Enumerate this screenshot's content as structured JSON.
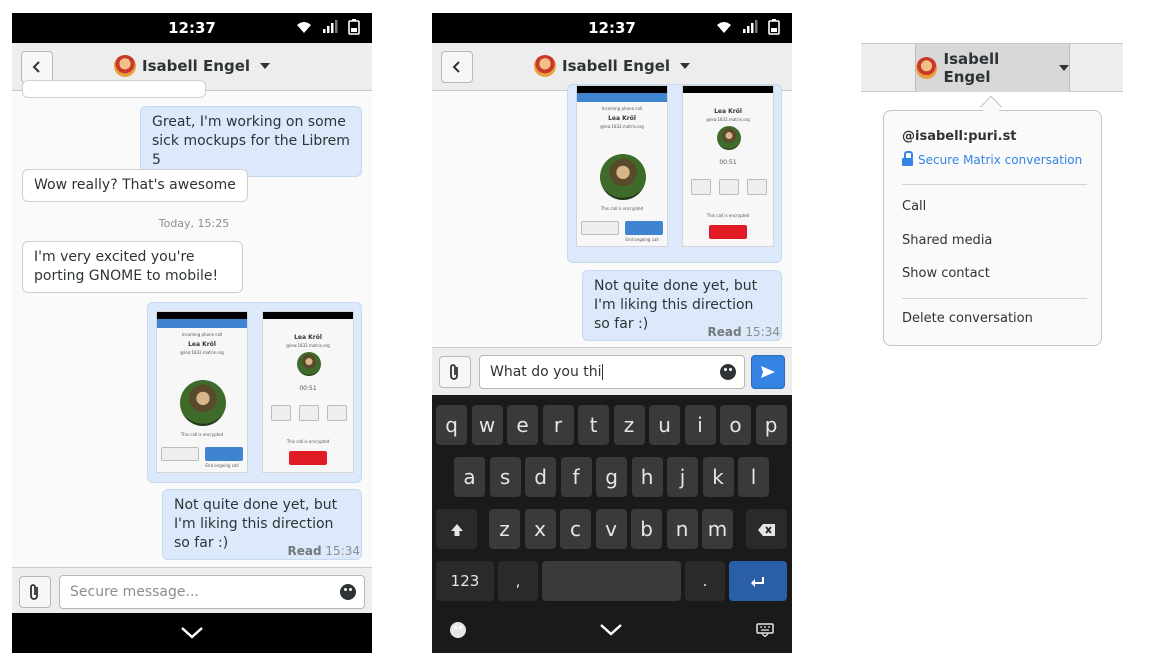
{
  "status": {
    "time": "12:37"
  },
  "header": {
    "contact_name": "Isabell Engel"
  },
  "chat": {
    "out1": "Great, I'm working on some sick mockups for the Librem 5",
    "in1": "Wow really? That's awesome",
    "date_sep": "Today, 15:25",
    "in2": "I'm very excited you're porting GNOME to mobile!",
    "out2": "Not quite done yet, but I'm liking this direction so far :)",
    "read_label": "Read",
    "read_time": "15:34"
  },
  "mini_mockup": {
    "time": "12:37",
    "header_left": "Martin Sergeyev",
    "header_right": "15:23",
    "incoming": "Incoming phone call",
    "name": "Lea Kröl",
    "handle": "@lea:1832.matrix.org",
    "timer": "00:51",
    "encrypted": "This call is encrypted",
    "end_call": "End ongoing call",
    "btn_mute": "Mute",
    "btn_audio": "Audio Video",
    "btn_speaker": "Speaker"
  },
  "compose": {
    "placeholder": "Secure message...",
    "typed_text": "What do you thi"
  },
  "keyboard": {
    "row1": [
      "q",
      "w",
      "e",
      "r",
      "t",
      "z",
      "u",
      "i",
      "o",
      "p"
    ],
    "row2": [
      "a",
      "s",
      "d",
      "f",
      "g",
      "h",
      "j",
      "k",
      "l"
    ],
    "row3": [
      "z",
      "x",
      "c",
      "v",
      "b",
      "n",
      "m"
    ],
    "num_key": "123",
    "comma_key": ",",
    "period_key": "."
  },
  "popover": {
    "user_id": "@isabell:puri.st",
    "secure_label": "Secure Matrix conversation",
    "items": [
      "Call",
      "Shared media",
      "Show contact"
    ],
    "danger_item": "Delete conversation"
  },
  "colors": {
    "accent": "#3584e4",
    "bubble_out": "#dbe9fb",
    "keyboard_bg": "#1a1a1a"
  },
  "icons": [
    "back-arrow-icon",
    "dropdown-arrow-icon",
    "wifi-icon",
    "signal-icon",
    "battery-icon",
    "attach-icon",
    "emoji-icon",
    "send-icon",
    "chevron-down-icon",
    "shift-icon",
    "backspace-icon",
    "enter-icon",
    "keyboard-icon",
    "lock-icon"
  ]
}
